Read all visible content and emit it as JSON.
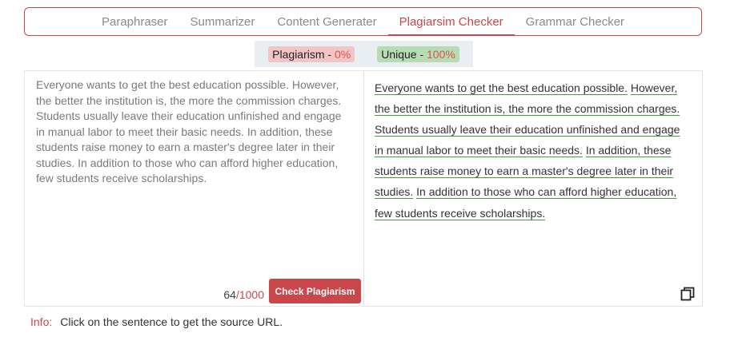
{
  "tabs": [
    {
      "label": "Paraphraser"
    },
    {
      "label": "Summarizer"
    },
    {
      "label": "Content Generater"
    },
    {
      "label": "Plagiarsim Checker"
    },
    {
      "label": "Grammar Checker"
    }
  ],
  "stats": {
    "plagiarism_label": "Plagiarism - ",
    "plagiarism_value": "0%",
    "unique_label": "Unique - ",
    "unique_value": "100%"
  },
  "input": {
    "text": "Everyone wants to get the best education possible. However, the better the institution is, the more the commission charges. Students usually leave their education unfinished and engage in manual labor to meet their basic needs. In addition, these students raise money to earn a master's degree later in their studies. In addition to those who can afford higher education, few students receive scholarships.",
    "count": "64",
    "max": "/1000",
    "button_label": "Check Plagiarism"
  },
  "result": {
    "sentences": [
      "Everyone wants to get the best education possible.",
      "However, the better the institution is, the more the commission charges.",
      "Students usually leave their education unfinished and engage in manual labor to meet their basic needs.",
      "In addition, these students raise money to earn a master's degree later in their studies.",
      "In addition to those who can afford higher education, few students receive scholarships."
    ]
  },
  "info": {
    "label": "Info:",
    "text": "Click on the sentence to get the source URL."
  },
  "colors": {
    "accent": "#c9474b",
    "plagiarism_bg": "#f1c4c6",
    "unique_bg": "#b7dcb4",
    "underline": "#3aa13c"
  },
  "icons": {
    "copy": "copy-icon"
  }
}
